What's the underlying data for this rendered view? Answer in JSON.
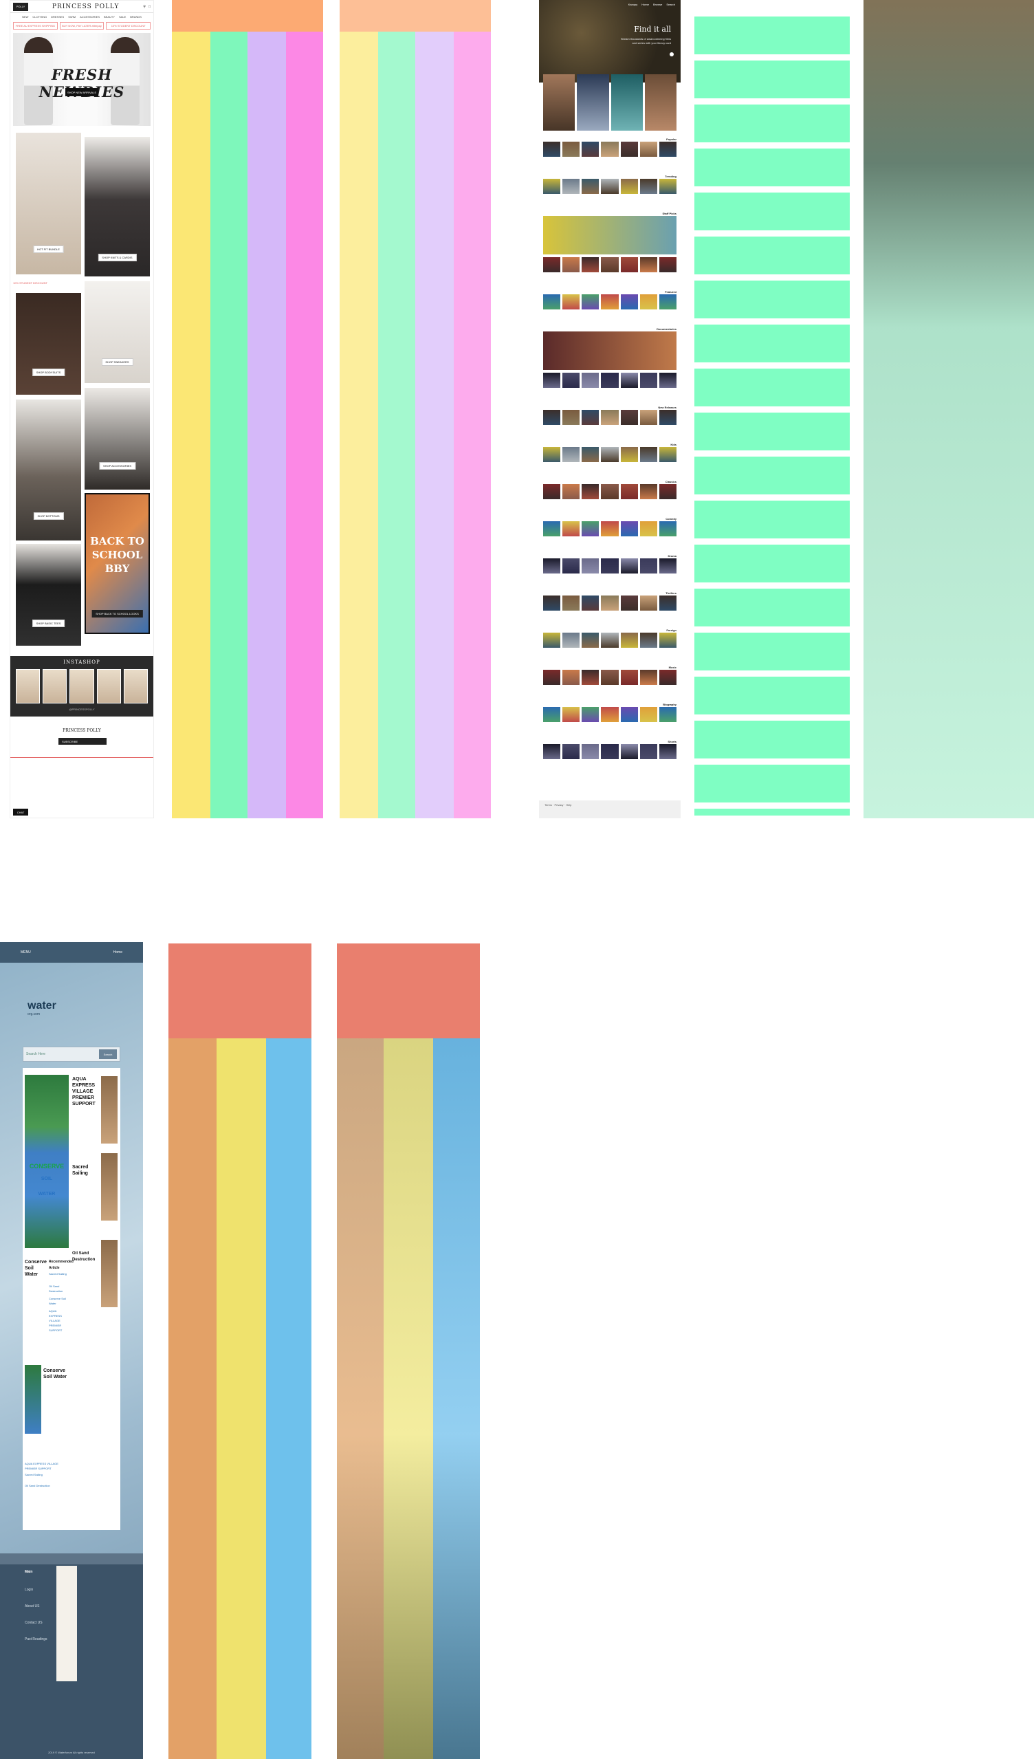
{
  "pp": {
    "logo_box": "POLLY",
    "brand": "PRINCESS POLLY",
    "nav": [
      "NEW",
      "CLOTHING",
      "DRESSES",
      "SWIM",
      "ACCESSORIES",
      "BEAUTY",
      "SALE",
      "BRANDS"
    ],
    "promos": [
      "FREE AU EXPRESS SHIPPING",
      "BUY NOW, PAY LATER afterpay",
      "10% STUDENT DISCOUNT"
    ],
    "hero_title": "FRESH NEWBIES",
    "hero_button": "SHOP NEW ARRIVALS",
    "tiles": {
      "hot_fit": "HOT FIT BUNDLE",
      "knits": "SHOP KNITS & CARDIS",
      "student_strip": "10% STUDENT DISCOUNT",
      "bodysuits": "SHOP BODYSUITS",
      "sneakers": "SHOP SNEAKERS",
      "accessories": "SHOP ACCESSORIES",
      "bottoms": "SHOP BOTTOMS",
      "back_title": "BACK TO SCHOOL BBY",
      "back_button": "SHOP BACK TO SCHOOL LOOKS",
      "tees": "SHOP BASIC TEES"
    },
    "insta_title": "INSTASHOP",
    "insta_foot": "@PRINCESSPOLLY",
    "footer_brand": "PRINCESS POLLY",
    "newsletter": "SUBSCRIBE",
    "chat": "CHAT"
  },
  "st": {
    "nav": [
      "Kanopy",
      "Home",
      "Browse",
      "Search"
    ],
    "hero_title": "Find it all",
    "hero_sub": "Stream thousands of award-winning films and series with your library card",
    "sections": [
      "Popular",
      "Trending",
      "Staff Picks",
      "Featured",
      "Documentaries",
      "New Releases",
      "Kids",
      "Classics",
      "Comedy",
      "Drama",
      "Thrillers",
      "Foreign",
      "Music",
      "Biography",
      "Shorts"
    ],
    "footer": "Terms · Privacy · Help"
  },
  "ws": {
    "top_left": "MENU",
    "top_right": "Home",
    "logo_big": "water",
    "logo_small": "org.com",
    "search_placeholder": "Search Here",
    "search_button": "Search",
    "feature_text": [
      "CONSERVE",
      "SOIL",
      "WATER"
    ],
    "article1_title": "AQUA EXPRESS VILLAGE PREMIER SUPPORT",
    "article2_title": "Sacred Sailing",
    "article3_title": "Conserve Soil Water",
    "article4_title": "Recommended Article",
    "article5_title": "Oil Sand Destruction",
    "links": [
      "Sacred Sailing",
      "Oil Sand Destruction",
      "Conserve Soil Water",
      "AQUA EXPRESS VILLAGE PREMIER SUPPORT"
    ],
    "menu": [
      "Main",
      "Login",
      "About US",
      "Contact US",
      "Past Readings"
    ],
    "copyright": "2019 © Waterforum All rights reserved"
  }
}
